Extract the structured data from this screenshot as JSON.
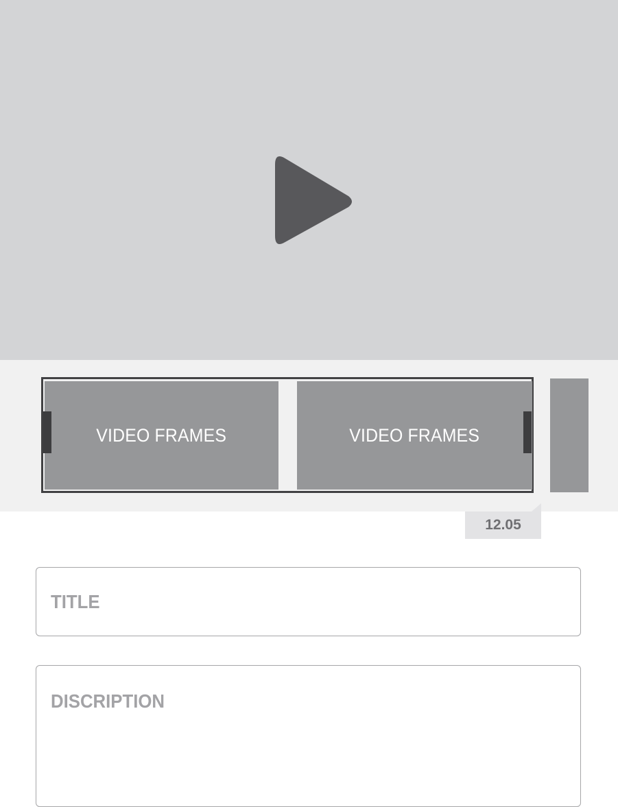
{
  "player": {
    "play_icon": "play-icon",
    "colors": {
      "background": "#d3d4d6",
      "icon": "#58585b"
    }
  },
  "timeline": {
    "frames": [
      {
        "label": "VIDEO FRAMES"
      },
      {
        "label": "VIDEO FRAMES"
      }
    ],
    "time_badge": "12.05",
    "colors": {
      "frame": "#969799",
      "border": "#414143"
    }
  },
  "form": {
    "title_placeholder": "TITLE",
    "description_placeholder": "DISCRIPTION"
  }
}
